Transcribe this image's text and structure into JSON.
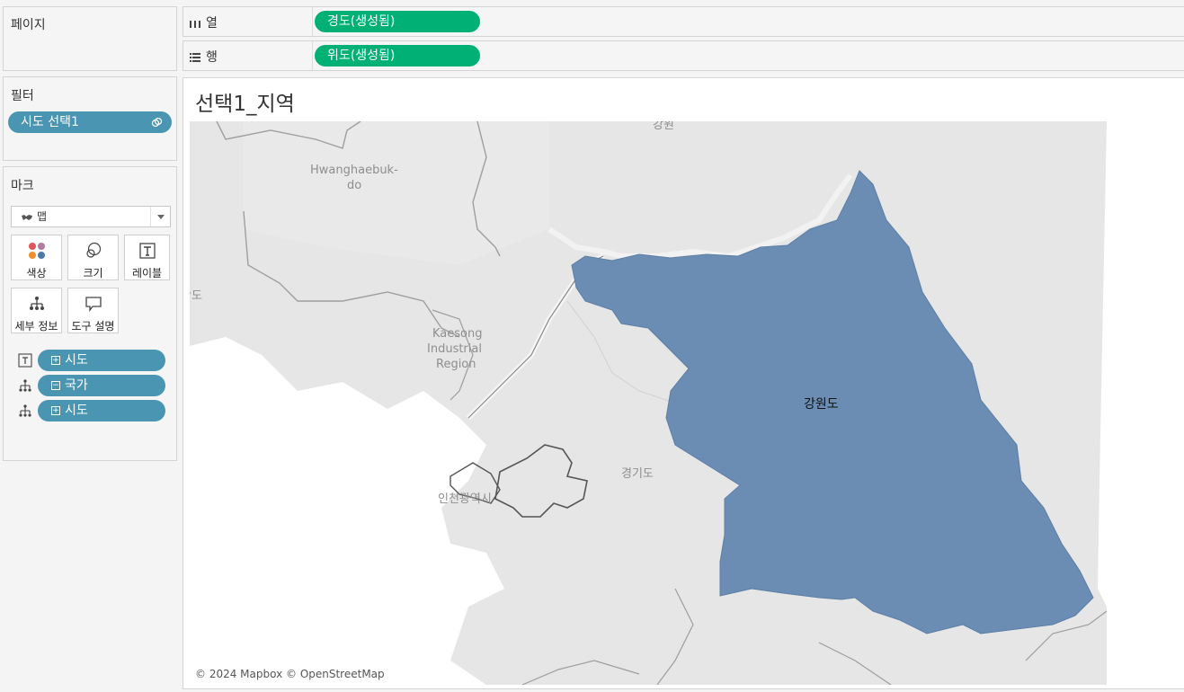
{
  "pages": {
    "title": "페이지"
  },
  "filters": {
    "title": "필터",
    "items": [
      {
        "label": "시도 선택1"
      }
    ]
  },
  "marks": {
    "title": "마크",
    "mark_type": "맵",
    "buttons": {
      "color": "색상",
      "size": "크기",
      "label": "레이블",
      "detail": "세부 정보",
      "tooltip": "도구 설명"
    },
    "fields": [
      {
        "role": "label",
        "expand": "+",
        "name": "시도"
      },
      {
        "role": "detail",
        "expand": "−",
        "name": "국가"
      },
      {
        "role": "detail",
        "expand": "+",
        "name": "시도"
      }
    ]
  },
  "shelves": {
    "columns": {
      "label": "열",
      "pill": "경도(생성됨)"
    },
    "rows": {
      "label": "행",
      "pill": "위도(생성됨)"
    }
  },
  "view": {
    "title": "선택1_지역",
    "map_labels": {
      "region_selected": "강원도",
      "gyeonggi": "경기도",
      "incheon": "인천광역시",
      "hwanghaebuk_1": "Hwanghaebuk-",
      "hwanghaebuk_2": "do",
      "kaesong_1": "Kaesong",
      "kaesong_2": "Industrial",
      "kaesong_3": "Region",
      "gangwon_top": "강원",
      "edge_do": "황도"
    },
    "attribution": "© 2024 Mapbox © OpenStreetMap"
  },
  "colors": {
    "pill_blue": "#4a95b2",
    "pill_green": "#00b075",
    "region_fill": "#6b8db3"
  }
}
